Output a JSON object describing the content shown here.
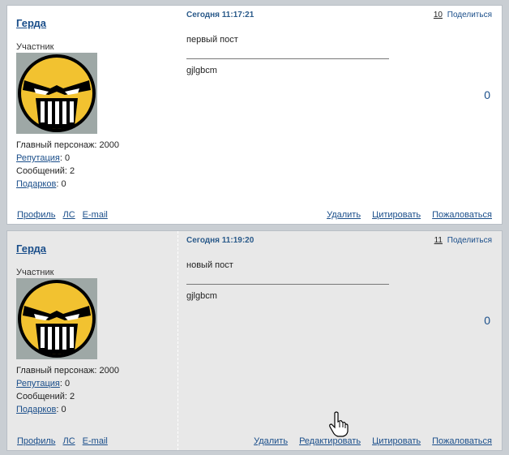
{
  "posts": [
    {
      "author": "Герда",
      "role": "Участник",
      "main_character_label": "Главный персонаж:",
      "main_character_value": "2000",
      "reputation_label": "Репутация",
      "reputation_value": ": 0",
      "messages_label": "Сообщений:",
      "messages_value": "2",
      "gifts_label": "Подарков",
      "gifts_value": ": 0",
      "links": {
        "profile": "Профиль",
        "pm": "ЛС",
        "email": "E-mail"
      },
      "date": "Сегодня 11:17:21",
      "number": "10",
      "share": "Поделиться",
      "text": "первый пост",
      "signature": "gjlgbcm",
      "rating": "0",
      "actions": {
        "delete": "Удалить",
        "quote": "Цитировать",
        "report": "Пожаловаться"
      }
    },
    {
      "author": "Герда",
      "role": "Участник",
      "main_character_label": "Главный персонаж:",
      "main_character_value": "2000",
      "reputation_label": "Репутация",
      "reputation_value": ": 0",
      "messages_label": "Сообщений:",
      "messages_value": "2",
      "gifts_label": "Подарков",
      "gifts_value": ": 0",
      "links": {
        "profile": "Профиль",
        "pm": "ЛС",
        "email": "E-mail"
      },
      "date": "Сегодня 11:19:20",
      "number": "11",
      "share": "Поделиться",
      "text": "новый пост",
      "signature": "gjlgbcm",
      "rating": "0",
      "actions": {
        "delete": "Удалить",
        "edit": "Редактировать",
        "quote": "Цитировать",
        "report": "Пожаловаться"
      }
    }
  ],
  "colors": {
    "link": "#1a4e8a",
    "post1_bg": "#ffffff",
    "post2_bg": "#e8e8e8",
    "page_bg": "#c9ced3",
    "avatar_face": "#f2c230"
  },
  "icons": {
    "avatar": "angry-mask-avatar-icon",
    "cursor": "hand-pointer-icon"
  }
}
